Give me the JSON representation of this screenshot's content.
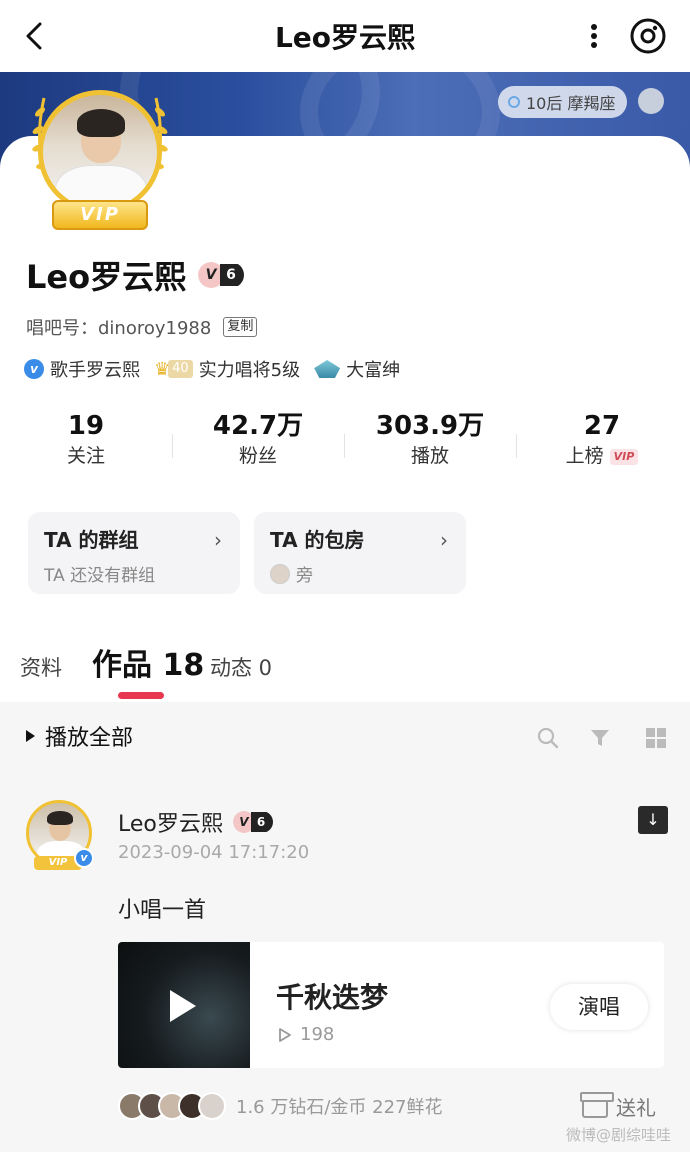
{
  "header": {
    "title": "Leo罗云熙",
    "back_icon": "chevron-left-icon",
    "more_icon": "more-vertical-icon",
    "camera_icon": "camera-icon"
  },
  "banner": {
    "zodiac_label": "10后 摩羯座"
  },
  "profile": {
    "vip_ribbon": "VIP",
    "name": "Leo罗云熙",
    "level_badge": {
      "v": "V",
      "num": "6"
    },
    "id_label": "唱吧号：",
    "id_value": "dinoroy1988",
    "copy_label": "复制",
    "tags": {
      "verified_label": "歌手罗云熙",
      "crown_level": "40",
      "rank_label": "实力唱将5级",
      "rich_label": "大富绅"
    },
    "stats": [
      {
        "num": "19",
        "label": "关注"
      },
      {
        "num": "42.7万",
        "label": "粉丝"
      },
      {
        "num": "303.9万",
        "label": "播放"
      },
      {
        "num": "27",
        "label": "上榜",
        "vip": "VIP"
      }
    ],
    "group_box": {
      "title": "TA 的群组",
      "sub": "TA 还没有群组"
    },
    "room_box": {
      "title": "TA 的包房",
      "sub": "旁"
    }
  },
  "tabs": [
    {
      "label": "资料"
    },
    {
      "label": "作品 18",
      "active": true
    },
    {
      "label": "动态 0"
    }
  ],
  "toolbar": {
    "play_all": "播放全部"
  },
  "post": {
    "author": "Leo罗云熙",
    "level_badge": {
      "v": "V",
      "num": "6"
    },
    "avatar_vip": "VIP",
    "time": "2023-09-04 17:17:20",
    "text": "小唱一首",
    "song": {
      "title": "千秋迭梦",
      "plays": "198",
      "sing_label": "演唱"
    },
    "gift_summary": "1.6 万钻石/金币  227鲜花",
    "send_gift_label": "送礼"
  },
  "watermark": "微博@剧综哇哇",
  "colors": {
    "accent_red": "#e8384f",
    "gold": "#f1c134",
    "verified_blue": "#3b8ce8"
  }
}
